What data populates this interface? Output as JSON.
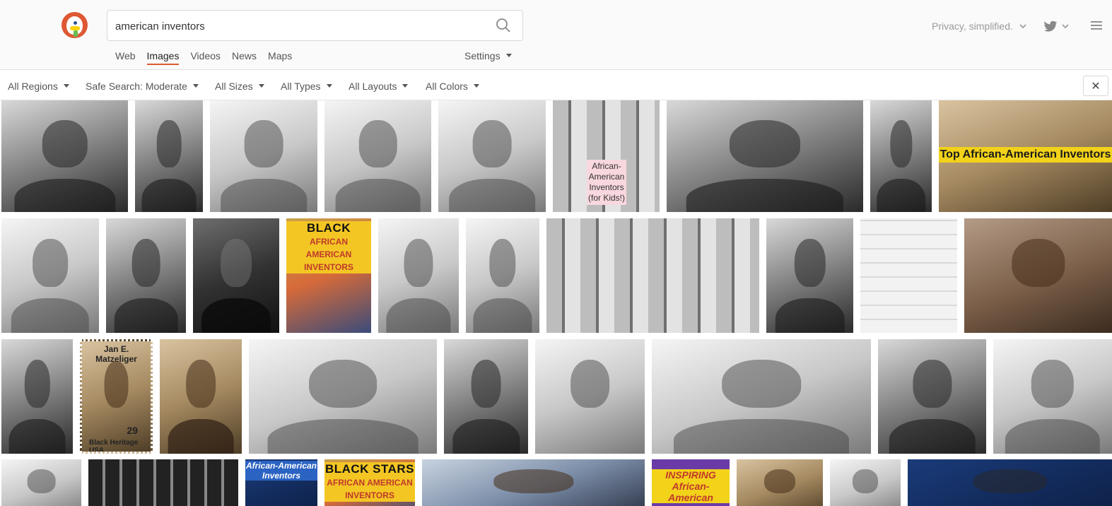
{
  "search": {
    "query": "american inventors"
  },
  "nav": {
    "tabs": [
      "Web",
      "Images",
      "Videos",
      "News",
      "Maps"
    ],
    "active_tab": "Images",
    "settings_label": "Settings"
  },
  "header": {
    "tagline": "Privacy, simplified."
  },
  "filters": {
    "region": "All Regions",
    "safe_search": "Safe Search: Moderate",
    "size": "All Sizes",
    "type": "All Types",
    "layout": "All Layouts",
    "color": "All Colors"
  },
  "image_overlays": {
    "kids_collage": "African-American Inventors (for Kids!)",
    "top_banner": "Top African-American Inventors",
    "black_stars_1": "BLACK STARS",
    "black_stars_2": "AFRICAN AMERICAN INVENTORS",
    "stamp_name": "Jan E. Matzeliger",
    "stamp_value": "29",
    "stamp_series": "Black Heritage USA",
    "aai_cover": "African-American Inventors",
    "inspiring": "INSPIRING African-American"
  },
  "colors": {
    "accent": "#de5833",
    "banner_yellow": "#f3d21a"
  },
  "icons": [
    "search-icon",
    "chevron-down-icon",
    "twitter-icon",
    "menu-icon",
    "close-icon"
  ]
}
